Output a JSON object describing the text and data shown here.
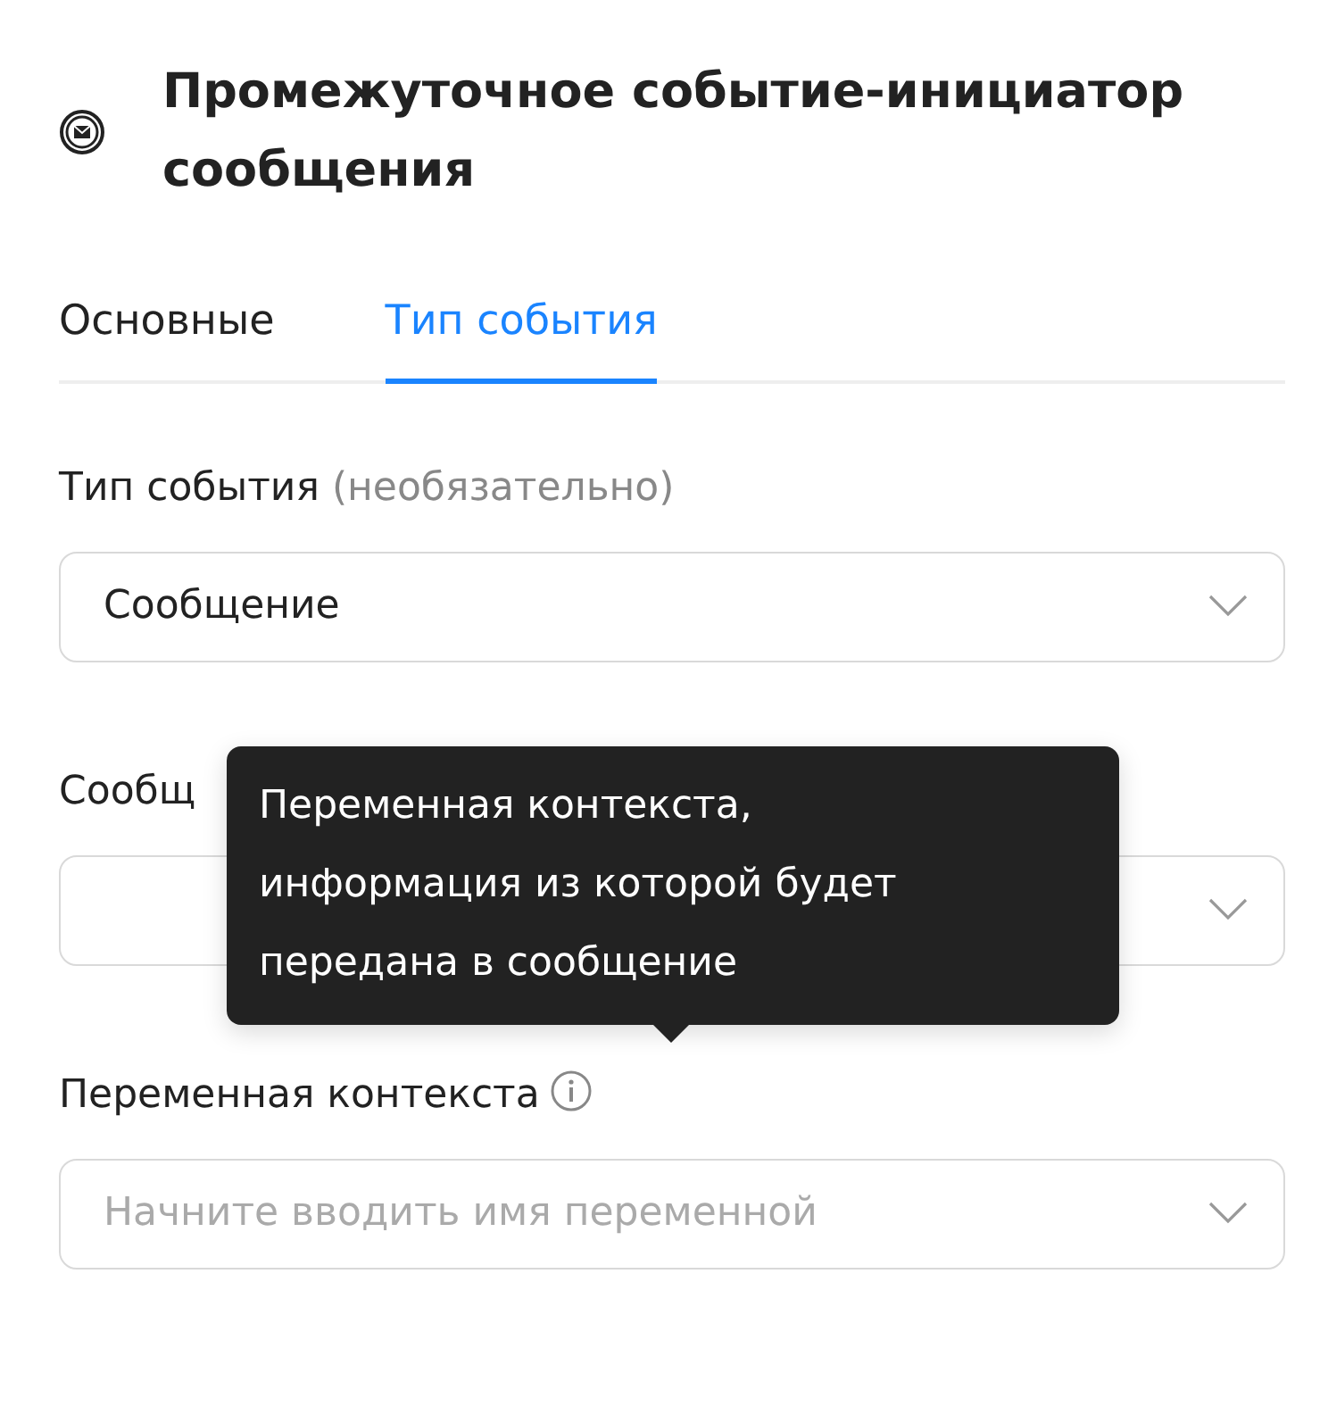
{
  "header": {
    "title": "Промежуточное событие-инициатор сообщения"
  },
  "tabs": [
    {
      "label": "Основные",
      "selected": false
    },
    {
      "label": "Тип события",
      "selected": true
    }
  ],
  "fields": [
    {
      "label": "Тип события",
      "note": "(необязательно)",
      "value": "Сообщение"
    },
    {
      "label": "Сообщ"
    },
    {
      "label": "Переменная контекста",
      "info": true,
      "placeholder": "Начните вводить имя переменной"
    }
  ],
  "tooltip": {
    "text": "Переменная контекста, информация из которой будет передана в сообщение"
  }
}
